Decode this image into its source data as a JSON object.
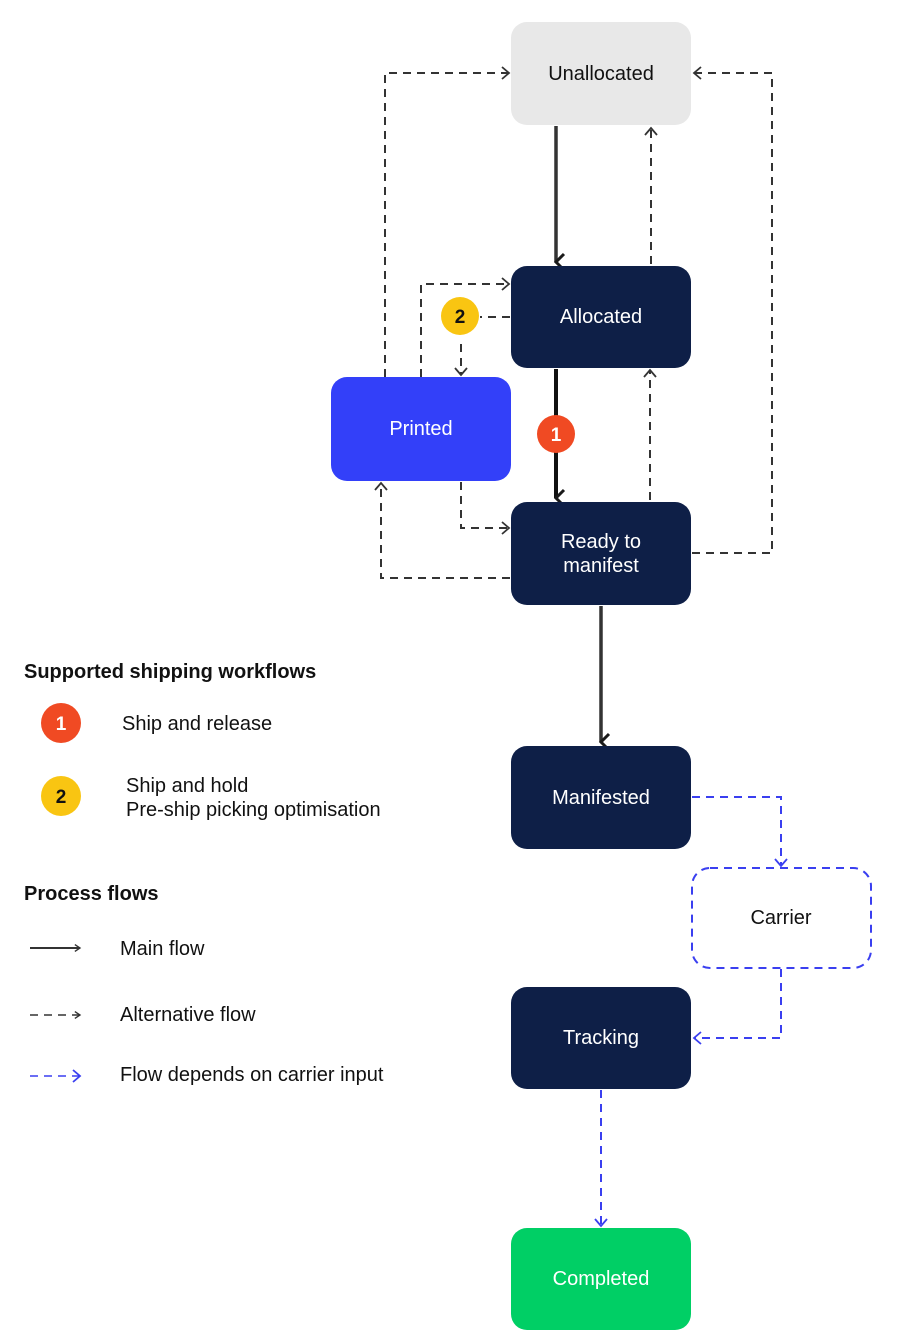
{
  "nodes": {
    "unallocated": {
      "label": "Unallocated",
      "color": "#e8e8e8"
    },
    "allocated": {
      "label": "Allocated",
      "color": "#0e1f47"
    },
    "printed": {
      "label": "Printed",
      "color": "#3340f9"
    },
    "ready": {
      "label_line1": "Ready to",
      "label_line2": "manifest",
      "color": "#0e1f47"
    },
    "manifested": {
      "label": "Manifested",
      "color": "#0e1f47"
    },
    "carrier": {
      "label": "Carrier",
      "color": "#3a3ff0"
    },
    "tracking": {
      "label": "Tracking",
      "color": "#0e1f47"
    },
    "completed": {
      "label": "Completed",
      "color": "#00cf65"
    }
  },
  "badges": {
    "one": {
      "label": "1",
      "color": "#f04a23"
    },
    "two": {
      "label": "2",
      "color": "#f9c512"
    }
  },
  "legend": {
    "workflows_title": "Supported shipping workflows",
    "workflow_1": "Ship and release",
    "workflow_2_line1": "Ship and hold",
    "workflow_2_line2": "Pre-ship picking optimisation",
    "flows_title": "Process flows",
    "main_flow": "Main flow",
    "alternative_flow": "Alternative flow",
    "carrier_flow": "Flow depends on carrier input"
  }
}
